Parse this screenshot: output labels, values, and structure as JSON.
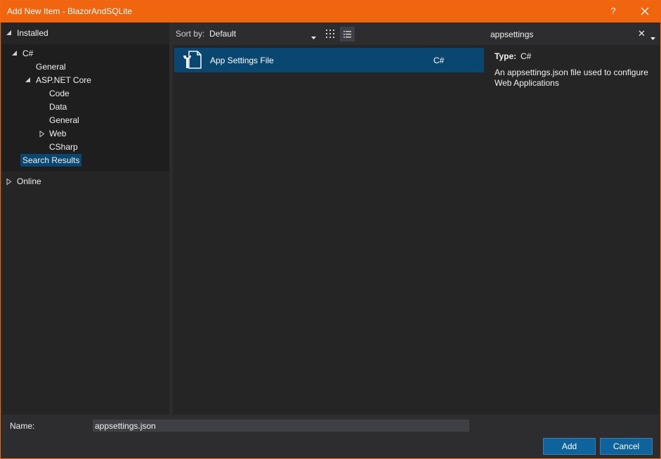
{
  "window": {
    "title": "Add New Item - BlazorAndSQLite",
    "help_label": "?"
  },
  "tree": {
    "installed": "Installed",
    "csharp": "C#",
    "general": "General",
    "aspnet": "ASP.NET Core",
    "code": "Code",
    "data": "Data",
    "general2": "General",
    "web": "Web",
    "csharp2": "CSharp",
    "search_results": "Search Results",
    "online": "Online"
  },
  "sort": {
    "label": "Sort by:",
    "value": "Default"
  },
  "items": [
    {
      "name": "App Settings File",
      "language": "C#"
    }
  ],
  "search": {
    "value": "appsettings",
    "clear_label": "✕"
  },
  "details": {
    "type_label": "Type:",
    "type_value": "C#",
    "description": "An appsettings.json file used to configure Web Applications"
  },
  "name_field": {
    "label": "Name:",
    "value": "appsettings.json"
  },
  "buttons": {
    "add": "Add",
    "cancel": "Cancel"
  },
  "colors": {
    "accent": "#f0650e",
    "selection": "#094771",
    "button": "#0e639c"
  },
  "icons": {
    "help": "question-mark-icon",
    "close": "close-icon",
    "grid_view": "grid-view-icon",
    "list_view": "list-view-icon",
    "item": "settings-file-icon"
  }
}
